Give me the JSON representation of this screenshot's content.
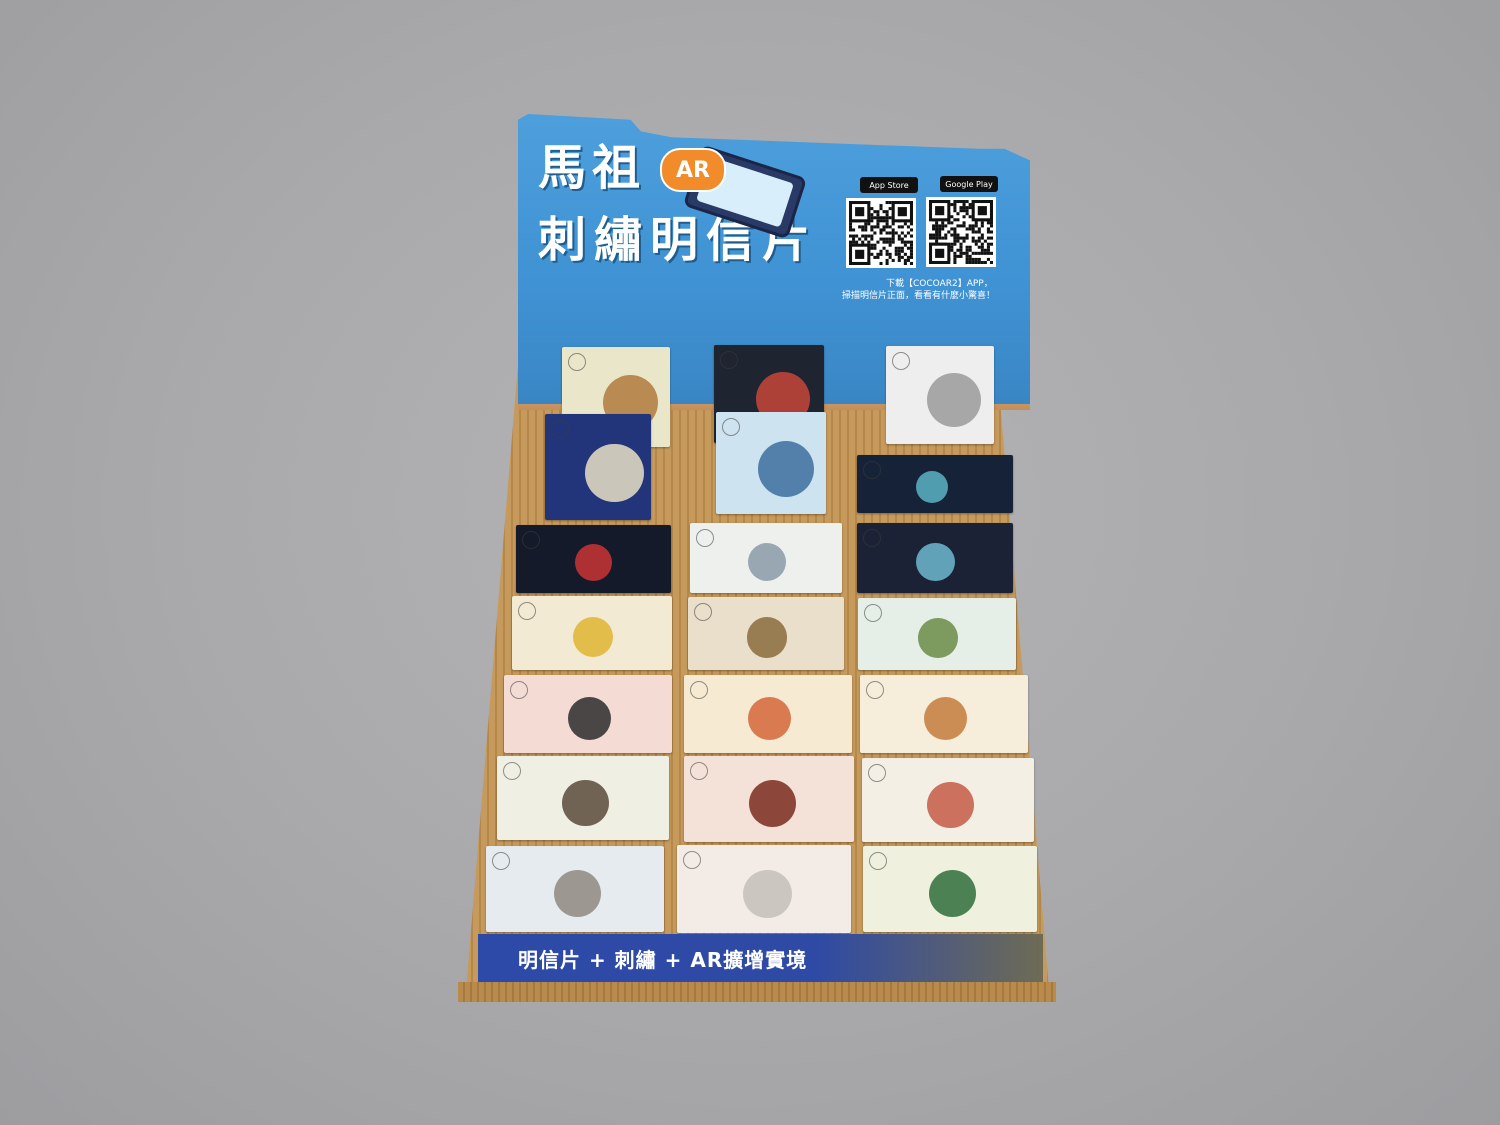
{
  "header": {
    "title_line1": "馬祖",
    "title_line2": "刺繡明信片",
    "ar_label": "AR",
    "badges": [
      "App Store",
      "Google Play"
    ],
    "instruction_line1": "下載【COCOAR2】APP，",
    "instruction_line2": "掃描明信片正面，看看有什麼小驚喜！"
  },
  "banner": {
    "text": "明信片 + 刺繡 + AR擴增實境"
  },
  "colors": {
    "board_blue": "#4d9fdc",
    "banner_blue": "#2d4aa8",
    "cardboard": "#c69a5c",
    "ar_orange": "#f28b2a"
  }
}
